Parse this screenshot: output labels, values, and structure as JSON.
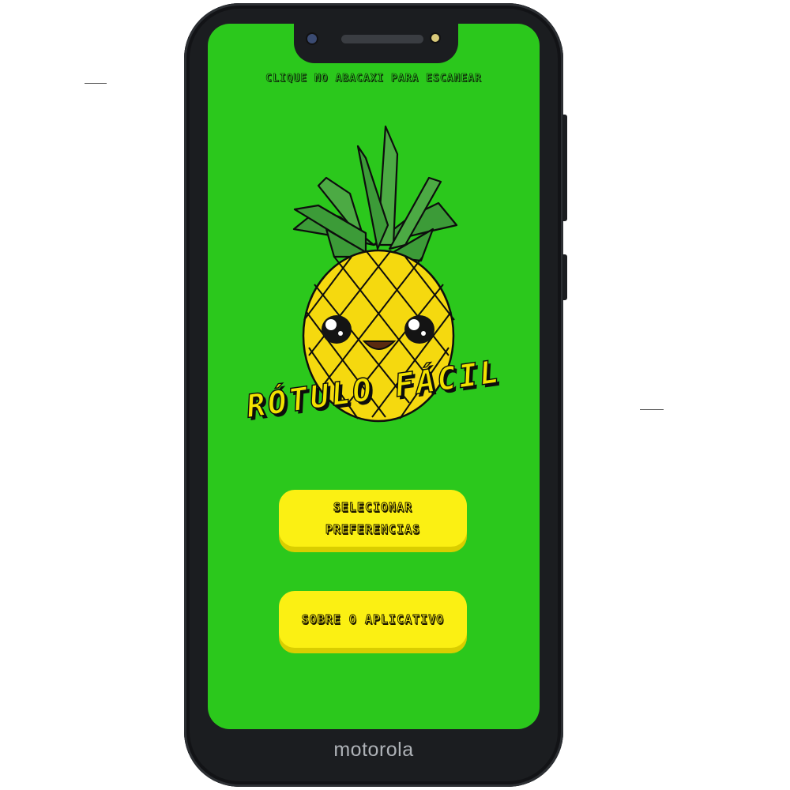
{
  "screen": {
    "scan_hint": "CLIQUE NO ABACAXI PARA ESCANEAR",
    "logo_text": "RÓTULO FÁCIL",
    "buttons": {
      "preferences": "SELECIONAR\nPREFERENCIAS",
      "about": "SOBRE O APLICATIVO"
    }
  },
  "device": {
    "brand": "motorola"
  },
  "colors": {
    "screen_background": "#2bc81c",
    "button_fill": "#fbf013",
    "pineapple_body": "#f5d90f",
    "pineapple_leaves": "#3c9b38",
    "device_body": "#1b1d20"
  },
  "icons": {
    "logo": "pineapple-mascot-icon"
  }
}
